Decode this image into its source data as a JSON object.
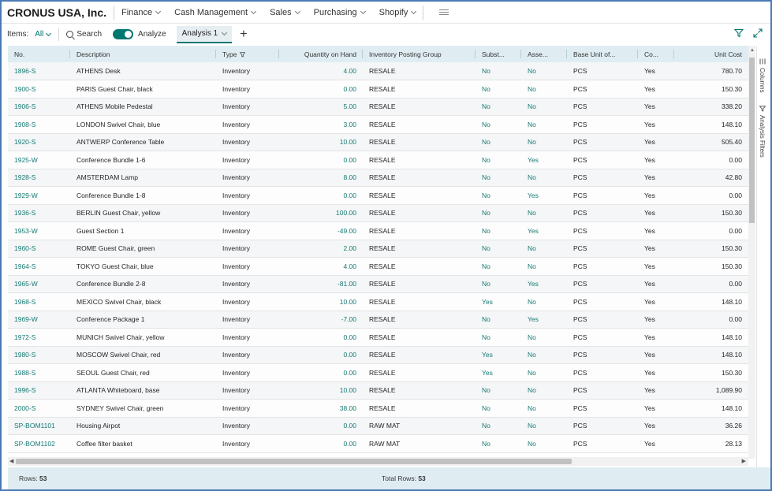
{
  "app": {
    "company": "CRONUS USA, Inc.",
    "nav": [
      "Finance",
      "Cash Management",
      "Sales",
      "Purchasing",
      "Shopify"
    ]
  },
  "toolbar": {
    "items_label": "Items:",
    "items_filter": "All",
    "search_label": "Search",
    "analyze_label": "Analyze",
    "analyze_on": true,
    "analysis_tab": "Analysis 1"
  },
  "columns": [
    "No.",
    "Description",
    "Type",
    "Quantity on Hand",
    "Inventory Posting Group",
    "Subst...",
    "Asse...",
    "Base Unit of...",
    "Co...",
    "Unit Cost"
  ],
  "rows": [
    [
      "1896-S",
      "ATHENS Desk",
      "Inventory",
      "4.00",
      "RESALE",
      "No",
      "No",
      "PCS",
      "Yes",
      "780.70"
    ],
    [
      "1900-S",
      "PARIS Guest Chair, black",
      "Inventory",
      "0.00",
      "RESALE",
      "No",
      "No",
      "PCS",
      "Yes",
      "150.30"
    ],
    [
      "1906-S",
      "ATHENS Mobile Pedestal",
      "Inventory",
      "5.00",
      "RESALE",
      "No",
      "No",
      "PCS",
      "Yes",
      "338.20"
    ],
    [
      "1908-S",
      "LONDON Swivel Chair, blue",
      "Inventory",
      "3.00",
      "RESALE",
      "No",
      "No",
      "PCS",
      "Yes",
      "148.10"
    ],
    [
      "1920-S",
      "ANTWERP Conference Table",
      "Inventory",
      "10.00",
      "RESALE",
      "No",
      "No",
      "PCS",
      "Yes",
      "505.40"
    ],
    [
      "1925-W",
      "Conference Bundle 1-6",
      "Inventory",
      "0.00",
      "RESALE",
      "No",
      "Yes",
      "PCS",
      "Yes",
      "0.00"
    ],
    [
      "1928-S",
      "AMSTERDAM Lamp",
      "Inventory",
      "8.00",
      "RESALE",
      "No",
      "No",
      "PCS",
      "Yes",
      "42.80"
    ],
    [
      "1929-W",
      "Conference Bundle 1-8",
      "Inventory",
      "0.00",
      "RESALE",
      "No",
      "Yes",
      "PCS",
      "Yes",
      "0.00"
    ],
    [
      "1936-S",
      "BERLIN Guest Chair, yellow",
      "Inventory",
      "100.00",
      "RESALE",
      "No",
      "No",
      "PCS",
      "Yes",
      "150.30"
    ],
    [
      "1953-W",
      "Guest Section 1",
      "Inventory",
      "-49.00",
      "RESALE",
      "No",
      "Yes",
      "PCS",
      "Yes",
      "0.00"
    ],
    [
      "1960-S",
      "ROME Guest Chair, green",
      "Inventory",
      "2.00",
      "RESALE",
      "No",
      "No",
      "PCS",
      "Yes",
      "150.30"
    ],
    [
      "1964-S",
      "TOKYO Guest Chair, blue",
      "Inventory",
      "4.00",
      "RESALE",
      "No",
      "No",
      "PCS",
      "Yes",
      "150.30"
    ],
    [
      "1965-W",
      "Conference Bundle 2-8",
      "Inventory",
      "-81.00",
      "RESALE",
      "No",
      "Yes",
      "PCS",
      "Yes",
      "0.00"
    ],
    [
      "1968-S",
      "MEXICO Swivel Chair, black",
      "Inventory",
      "10.00",
      "RESALE",
      "Yes",
      "No",
      "PCS",
      "Yes",
      "148.10"
    ],
    [
      "1969-W",
      "Conference Package 1",
      "Inventory",
      "-7.00",
      "RESALE",
      "No",
      "Yes",
      "PCS",
      "Yes",
      "0.00"
    ],
    [
      "1972-S",
      "MUNICH Swivel Chair, yellow",
      "Inventory",
      "0.00",
      "RESALE",
      "No",
      "No",
      "PCS",
      "Yes",
      "148.10"
    ],
    [
      "1980-S",
      "MOSCOW Swivel Chair, red",
      "Inventory",
      "0.00",
      "RESALE",
      "Yes",
      "No",
      "PCS",
      "Yes",
      "148.10"
    ],
    [
      "1988-S",
      "SEOUL Guest Chair, red",
      "Inventory",
      "0.00",
      "RESALE",
      "Yes",
      "No",
      "PCS",
      "Yes",
      "150.30"
    ],
    [
      "1996-S",
      "ATLANTA Whiteboard, base",
      "Inventory",
      "10.00",
      "RESALE",
      "No",
      "No",
      "PCS",
      "Yes",
      "1,089.90"
    ],
    [
      "2000-S",
      "SYDNEY Swivel Chair, green",
      "Inventory",
      "38.00",
      "RESALE",
      "No",
      "No",
      "PCS",
      "Yes",
      "148.10"
    ],
    [
      "SP-BOM1101",
      "Housing Airpot",
      "Inventory",
      "0.00",
      "RAW MAT",
      "No",
      "No",
      "PCS",
      "Yes",
      "36.26"
    ],
    [
      "SP-BOM1102",
      "Coffee filter basket",
      "Inventory",
      "0.00",
      "RAW MAT",
      "No",
      "No",
      "PCS",
      "Yes",
      "28.13"
    ]
  ],
  "side_tabs": [
    "Columns",
    "Analysis Filters"
  ],
  "footer": {
    "rows_label": "Rows:",
    "rows_value": "53",
    "total_label": "Total Rows:",
    "total_value": "53"
  },
  "colors": {
    "accent": "#00776f",
    "header_bg": "#dfedf3",
    "link": "#167a74"
  },
  "icons": [
    "search-icon",
    "plus-icon",
    "filter-icon",
    "expand-icon",
    "menu-icon",
    "columns-icon",
    "analysis-filter-icon"
  ]
}
